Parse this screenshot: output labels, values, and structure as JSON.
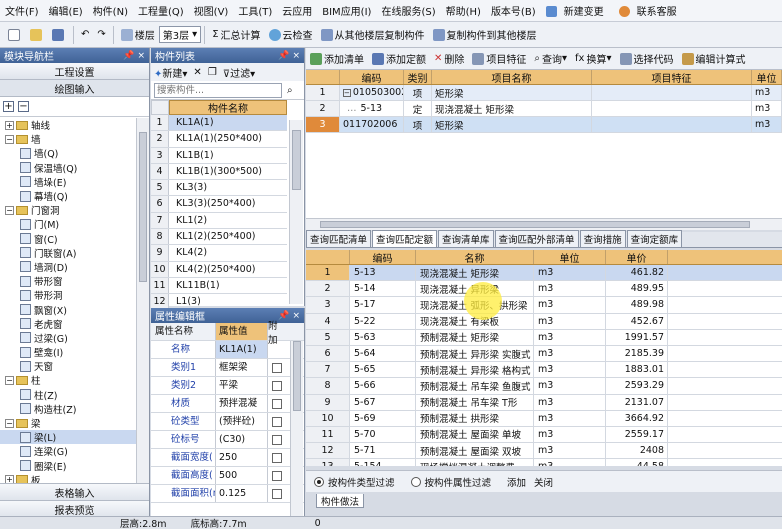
{
  "menu": {
    "items": [
      "文件(F)",
      "编辑(E)",
      "构件(N)",
      "工程量(Q)",
      "视图(V)",
      "工具(T)",
      "云应用",
      "BIM应用(I)",
      "在线服务(S)",
      "帮助(H)",
      "版本号(B)"
    ],
    "new_changes": "新建变更",
    "support": "联系客服"
  },
  "toolbar": {
    "floor_label": "楼层",
    "floor_value": "第3层",
    "sum_calc": "汇总计算",
    "cloud_check": "云检查",
    "copy_from_floor": "从其他楼层复制构件",
    "copy_to_floor": "复制构件到其他楼层"
  },
  "nav": {
    "title": "模块导航栏",
    "btn_project": "工程设置",
    "btn_drawing": "绘图输入",
    "tree": [
      {
        "label": "轴线",
        "level": 0,
        "type": "folder",
        "exp": "+"
      },
      {
        "label": "墙",
        "level": 0,
        "type": "folder",
        "exp": "-"
      },
      {
        "label": "墙(Q)",
        "level": 1,
        "type": "leaf"
      },
      {
        "label": "保温墙(Q)",
        "level": 1,
        "type": "leaf"
      },
      {
        "label": "墙垛(E)",
        "level": 1,
        "type": "leaf"
      },
      {
        "label": "幕墙(Q)",
        "level": 1,
        "type": "leaf"
      },
      {
        "label": "门窗洞",
        "level": 0,
        "type": "folder",
        "exp": "-"
      },
      {
        "label": "门(M)",
        "level": 1,
        "type": "leaf"
      },
      {
        "label": "窗(C)",
        "level": 1,
        "type": "leaf"
      },
      {
        "label": "门联窗(A)",
        "level": 1,
        "type": "leaf"
      },
      {
        "label": "墙洞(D)",
        "level": 1,
        "type": "leaf"
      },
      {
        "label": "带形窗",
        "level": 1,
        "type": "leaf"
      },
      {
        "label": "带形洞",
        "level": 1,
        "type": "leaf"
      },
      {
        "label": "飘窗(X)",
        "level": 1,
        "type": "leaf"
      },
      {
        "label": "老虎窗",
        "level": 1,
        "type": "leaf"
      },
      {
        "label": "过梁(G)",
        "level": 1,
        "type": "leaf"
      },
      {
        "label": "壁龛(I)",
        "level": 1,
        "type": "leaf"
      },
      {
        "label": "天窗",
        "level": 1,
        "type": "leaf"
      },
      {
        "label": "柱",
        "level": 0,
        "type": "folder",
        "exp": "-"
      },
      {
        "label": "柱(Z)",
        "level": 1,
        "type": "leaf"
      },
      {
        "label": "构造柱(Z)",
        "level": 1,
        "type": "leaf"
      },
      {
        "label": "梁",
        "level": 0,
        "type": "folder",
        "exp": "-"
      },
      {
        "label": "梁(L)",
        "level": 1,
        "type": "leaf"
      },
      {
        "label": "连梁(G)",
        "level": 1,
        "type": "leaf"
      },
      {
        "label": "圈梁(E)",
        "level": 1,
        "type": "leaf"
      },
      {
        "label": "板",
        "level": 0,
        "type": "folder",
        "exp": "+"
      },
      {
        "label": "楼梯",
        "level": 0,
        "type": "folder",
        "exp": "+"
      }
    ],
    "btn_table": "表格输入",
    "btn_report": "报表预览"
  },
  "components": {
    "title": "构件列表",
    "new_btn": "新建",
    "filter_btn": "过滤",
    "search_placeholder": "搜索构件...",
    "header": "构件名称",
    "rows": [
      "KL1A(1)",
      "KL1A(1)(250*400)",
      "KL1B(1)",
      "KL1B(1)(300*500)",
      "KL3(3)",
      "KL3(3)(250*400)",
      "KL1(2)",
      "KL1(2)(250*400)",
      "KL4(2)",
      "KL4(2)(250*400)",
      "KL11B(1)",
      "L1(3)"
    ]
  },
  "attributes": {
    "title": "属性编辑框",
    "h_name": "属性名称",
    "h_value": "属性值",
    "h_extra": "附加",
    "rows": [
      {
        "n": "名称",
        "v": "KL1A(1)"
      },
      {
        "n": "类别1",
        "v": "框架梁"
      },
      {
        "n": "类别2",
        "v": "平梁"
      },
      {
        "n": "材质",
        "v": "预拌混凝"
      },
      {
        "n": "砼类型",
        "v": "(预拌砼)"
      },
      {
        "n": "砼标号",
        "v": "(C30)"
      },
      {
        "n": "截面宽度(",
        "v": "250"
      },
      {
        "n": "截面高度(",
        "v": "500"
      },
      {
        "n": "截面面积(m",
        "v": "0.125"
      }
    ]
  },
  "quota_toolbar": {
    "add_list": "添加清单",
    "add_quota": "添加定额",
    "delete": "删除",
    "item_feature": "项目特征",
    "query": "查询",
    "convert": "换算",
    "select_code": "选择代码",
    "edit_formula": "编辑计算式",
    "unit_header": "单位"
  },
  "upper_grid": {
    "headers": [
      "编码",
      "类别",
      "项目名称",
      "项目特征",
      "单位"
    ],
    "rows": [
      {
        "n": "1",
        "code": "010503002",
        "type": "项",
        "name": "矩形梁",
        "feat": "",
        "unit": "m3"
      },
      {
        "n": "2",
        "code": "5-13",
        "type": "定",
        "name": "现浇混凝土 矩形梁",
        "feat": "",
        "unit": "m3"
      },
      {
        "n": "3",
        "code": "011702006",
        "type": "项",
        "name": "矩形梁",
        "feat": "",
        "unit": "m3"
      }
    ]
  },
  "tabs": [
    "查询匹配清单",
    "查询匹配定额",
    "查询清单库",
    "查询匹配外部清单",
    "查询措施",
    "查询定额库"
  ],
  "lower_grid": {
    "headers": [
      "编码",
      "名称",
      "单位",
      "单价"
    ],
    "rows": [
      {
        "n": "1",
        "code": "5-13",
        "name": "现浇混凝土 矩形梁",
        "unit": "m3",
        "price": "461.82"
      },
      {
        "n": "2",
        "code": "5-14",
        "name": "现浇混凝土 异形梁",
        "unit": "m3",
        "price": "489.95"
      },
      {
        "n": "3",
        "code": "5-17",
        "name": "现浇混凝土 弧形、拱形梁",
        "unit": "m3",
        "price": "489.98"
      },
      {
        "n": "4",
        "code": "5-22",
        "name": "现浇混凝土 有梁板",
        "unit": "m3",
        "price": "452.67"
      },
      {
        "n": "5",
        "code": "5-63",
        "name": "预制混凝土 矩形梁",
        "unit": "m3",
        "price": "1991.57"
      },
      {
        "n": "6",
        "code": "5-64",
        "name": "预制混凝土 异形梁 实腹式",
        "unit": "m3",
        "price": "2185.39"
      },
      {
        "n": "7",
        "code": "5-65",
        "name": "预制混凝土 异形梁 格构式",
        "unit": "m3",
        "price": "1883.01"
      },
      {
        "n": "8",
        "code": "5-66",
        "name": "预制混凝土 吊车梁 鱼腹式",
        "unit": "m3",
        "price": "2593.29"
      },
      {
        "n": "9",
        "code": "5-67",
        "name": "预制混凝土 吊车梁 T形",
        "unit": "m3",
        "price": "2131.07"
      },
      {
        "n": "10",
        "code": "5-69",
        "name": "预制混凝土 拱形梁",
        "unit": "m3",
        "price": "3664.92"
      },
      {
        "n": "11",
        "code": "5-70",
        "name": "预制混凝土 屋面梁 单坡",
        "unit": "m3",
        "price": "2559.17"
      },
      {
        "n": "12",
        "code": "5-71",
        "name": "预制混凝土 屋面梁 双坡",
        "unit": "m3",
        "price": "2408"
      },
      {
        "n": "13",
        "code": "5-154",
        "name": "现场搅拌混凝土调整费",
        "unit": "m3",
        "price": "44.58"
      }
    ]
  },
  "filter": {
    "by_type": "按构件类型过滤",
    "by_attr": "按构件属性过滤",
    "add": "添加",
    "close": "关闭",
    "bottom_tab": "构件做法"
  },
  "status": {
    "floor_height": "层高:2.8m",
    "floor_bottom": "底标高:7.7m",
    "zero": "0"
  }
}
